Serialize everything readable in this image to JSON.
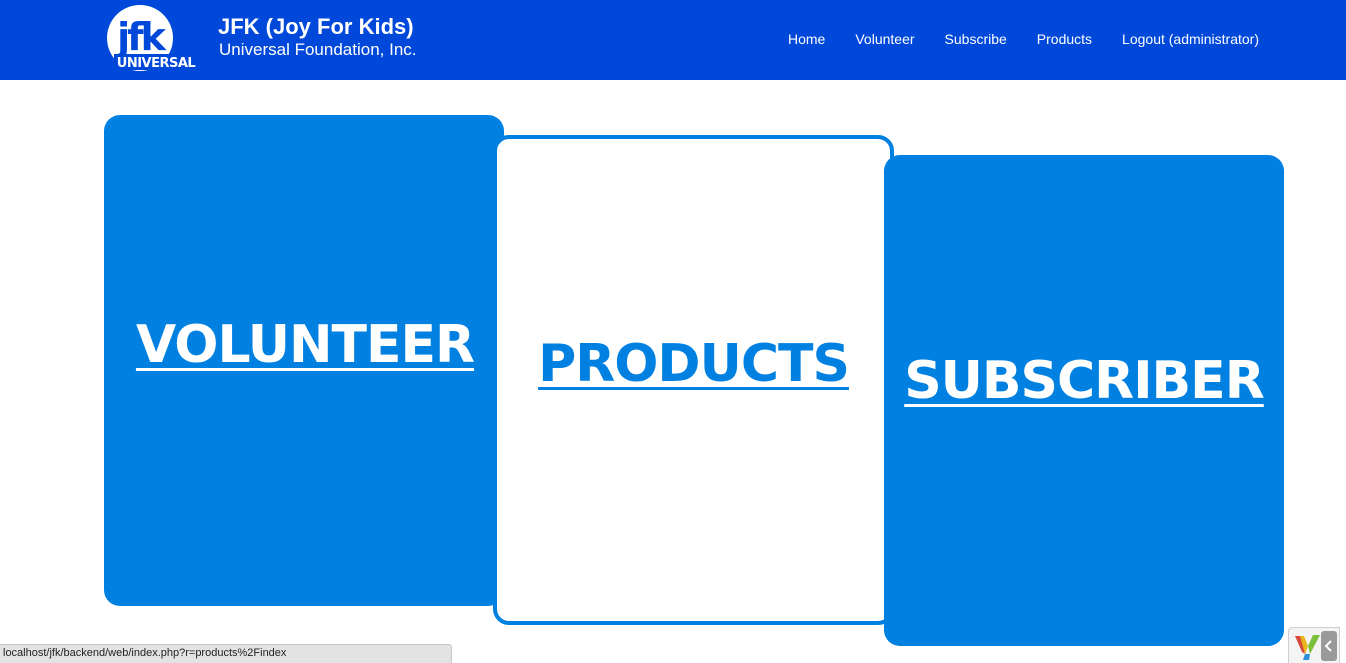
{
  "header": {
    "logo_top": "jfk",
    "logo_bottom": "UNIVERSAL",
    "title": "JFK (Joy For Kids)",
    "subtitle": "Universal Foundation, Inc."
  },
  "nav": {
    "items": [
      {
        "label": "Home"
      },
      {
        "label": "Volunteer"
      },
      {
        "label": "Subscribe"
      },
      {
        "label": "Products"
      },
      {
        "label": "Logout (administrator)"
      }
    ]
  },
  "cards": {
    "volunteer": {
      "label": "VOLUNTEER"
    },
    "products": {
      "label": "PRODUCTS"
    },
    "subscriber": {
      "label": "SUBSCRIBER"
    }
  },
  "statusbar": {
    "url": "localhost/jfk/backend/web/index.php?r=products%2Findex"
  },
  "colors": {
    "navbar": "#0048d9",
    "card_blue": "#0080e0",
    "white": "#ffffff"
  }
}
